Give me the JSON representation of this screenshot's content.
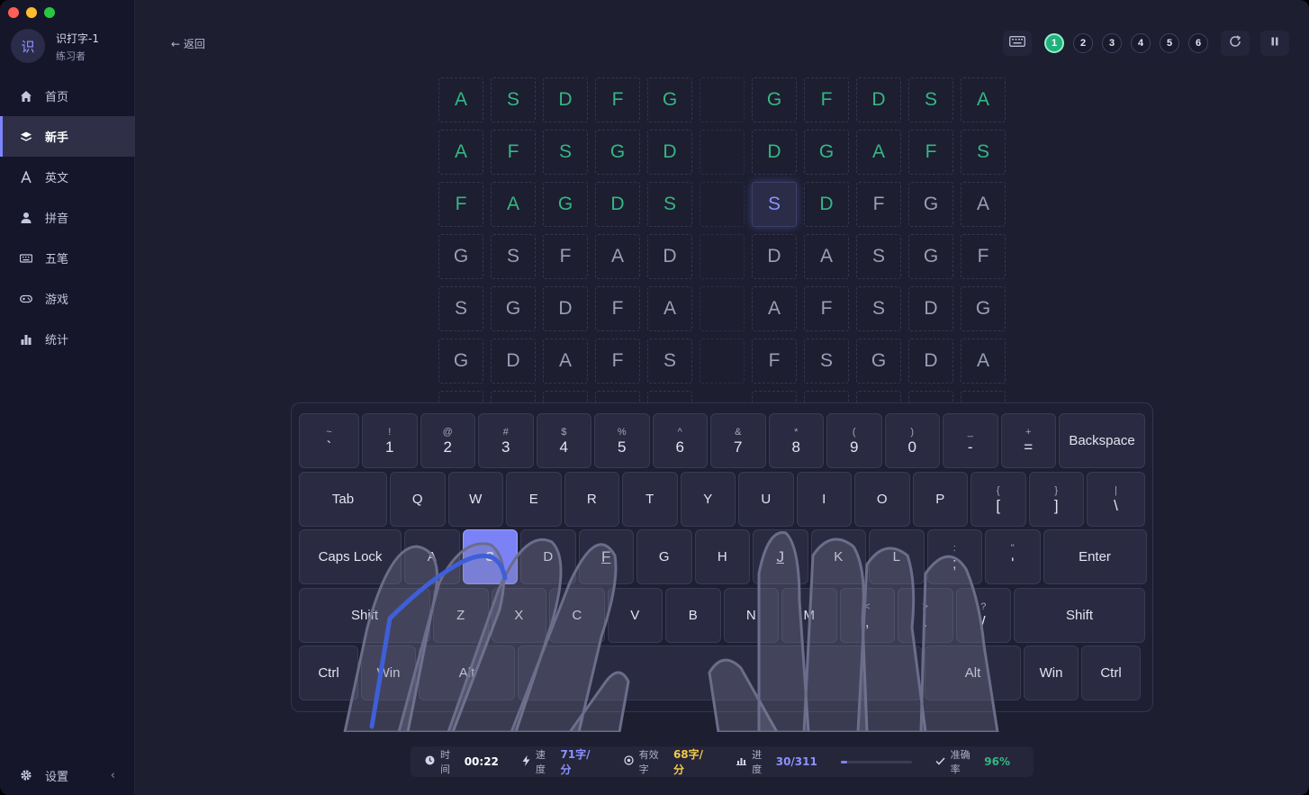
{
  "colors": {
    "accent": "#7b82f5",
    "done": "#34b784",
    "speed": "#8b92ff",
    "valid": "#f3c94a",
    "accuracy": "#34b784"
  },
  "window_controls": [
    "close",
    "minimize",
    "maximize"
  ],
  "user": {
    "avatar_text": "识",
    "name": "识打字-1",
    "role": "练习者"
  },
  "nav": [
    {
      "label": "首页",
      "icon": "home-icon",
      "active": false
    },
    {
      "label": "新手",
      "icon": "layers-icon",
      "active": true
    },
    {
      "label": "英文",
      "icon": "letter-a-icon",
      "active": false
    },
    {
      "label": "拼音",
      "icon": "user-icon",
      "active": false
    },
    {
      "label": "五笔",
      "icon": "keyboard-icon",
      "active": false
    },
    {
      "label": "游戏",
      "icon": "gamepad-icon",
      "active": false
    },
    {
      "label": "统计",
      "icon": "bar-chart-icon",
      "active": false
    }
  ],
  "settings": {
    "label": "设置",
    "collapse": "‹"
  },
  "header": {
    "back_label": "← 返回"
  },
  "levels": [
    "1",
    "2",
    "3",
    "4",
    "5",
    "6"
  ],
  "active_level": "1",
  "practice": {
    "rows": [
      [
        "A",
        "S",
        "D",
        "F",
        "G",
        "",
        "G",
        "F",
        "D",
        "S",
        "A"
      ],
      [
        "A",
        "F",
        "S",
        "G",
        "D",
        "",
        "D",
        "G",
        "A",
        "F",
        "S"
      ],
      [
        "F",
        "A",
        "G",
        "D",
        "S",
        "",
        "S",
        "D",
        "F",
        "G",
        "A"
      ],
      [
        "G",
        "S",
        "F",
        "A",
        "D",
        "",
        "D",
        "A",
        "S",
        "G",
        "F"
      ],
      [
        "S",
        "G",
        "D",
        "F",
        "A",
        "",
        "A",
        "F",
        "S",
        "D",
        "G"
      ],
      [
        "G",
        "D",
        "A",
        "F",
        "S",
        "",
        "F",
        "S",
        "G",
        "D",
        "A"
      ]
    ],
    "completed_count": 27,
    "current": {
      "row": 2,
      "col": 6
    }
  },
  "keyboard": {
    "row1": [
      {
        "top": "~",
        "bot": "`"
      },
      {
        "top": "!",
        "bot": "1"
      },
      {
        "top": "@",
        "bot": "2"
      },
      {
        "top": "#",
        "bot": "3"
      },
      {
        "top": "$",
        "bot": "4"
      },
      {
        "top": "%",
        "bot": "5"
      },
      {
        "top": "^",
        "bot": "6"
      },
      {
        "top": "&",
        "bot": "7"
      },
      {
        "top": "*",
        "bot": "8"
      },
      {
        "top": "(",
        "bot": "9"
      },
      {
        "top": ")",
        "bot": "0"
      },
      {
        "top": "_",
        "bot": "-"
      },
      {
        "top": "+",
        "bot": "="
      },
      {
        "label": "Backspace"
      }
    ],
    "row2": [
      {
        "label": "Tab"
      },
      {
        "label": "Q"
      },
      {
        "label": "W"
      },
      {
        "label": "E"
      },
      {
        "label": "R"
      },
      {
        "label": "T"
      },
      {
        "label": "Y"
      },
      {
        "label": "U"
      },
      {
        "label": "I"
      },
      {
        "label": "O"
      },
      {
        "label": "P"
      },
      {
        "top": "{",
        "bot": "["
      },
      {
        "top": "}",
        "bot": "]"
      },
      {
        "top": "|",
        "bot": "\\"
      }
    ],
    "row3": [
      {
        "label": "Caps Lock"
      },
      {
        "label": "A"
      },
      {
        "label": "S"
      },
      {
        "label": "D"
      },
      {
        "label": "F",
        "home": true
      },
      {
        "label": "G"
      },
      {
        "label": "H"
      },
      {
        "label": "J",
        "home": true
      },
      {
        "label": "K"
      },
      {
        "label": "L"
      },
      {
        "top": ":",
        "bot": ";"
      },
      {
        "top": "\"",
        "bot": "'"
      },
      {
        "label": "Enter"
      }
    ],
    "row4": [
      {
        "label": "Shift"
      },
      {
        "label": "Z"
      },
      {
        "label": "X"
      },
      {
        "label": "C"
      },
      {
        "label": "V"
      },
      {
        "label": "B"
      },
      {
        "label": "N"
      },
      {
        "label": "M"
      },
      {
        "top": "<",
        "bot": ","
      },
      {
        "top": ">",
        "bot": "."
      },
      {
        "top": "?",
        "bot": "/"
      },
      {
        "label": "Shift"
      }
    ],
    "row5": [
      {
        "label": "Ctrl"
      },
      {
        "label": "Win"
      },
      {
        "label": "Alt"
      },
      {
        "label": ""
      },
      {
        "label": "Alt"
      },
      {
        "label": "Win"
      },
      {
        "label": "Ctrl"
      }
    ],
    "highlighted": "S"
  },
  "stats": {
    "time_label": "时间",
    "time_value": "00:22",
    "speed_label": "速度",
    "speed_value": "71字/分",
    "valid_label": "有效字",
    "valid_value": "68字/分",
    "progress_label": "进度",
    "progress_value": "30/311",
    "progress_fraction": 0.096,
    "accuracy_label": "准确率",
    "accuracy_value": "96%"
  }
}
